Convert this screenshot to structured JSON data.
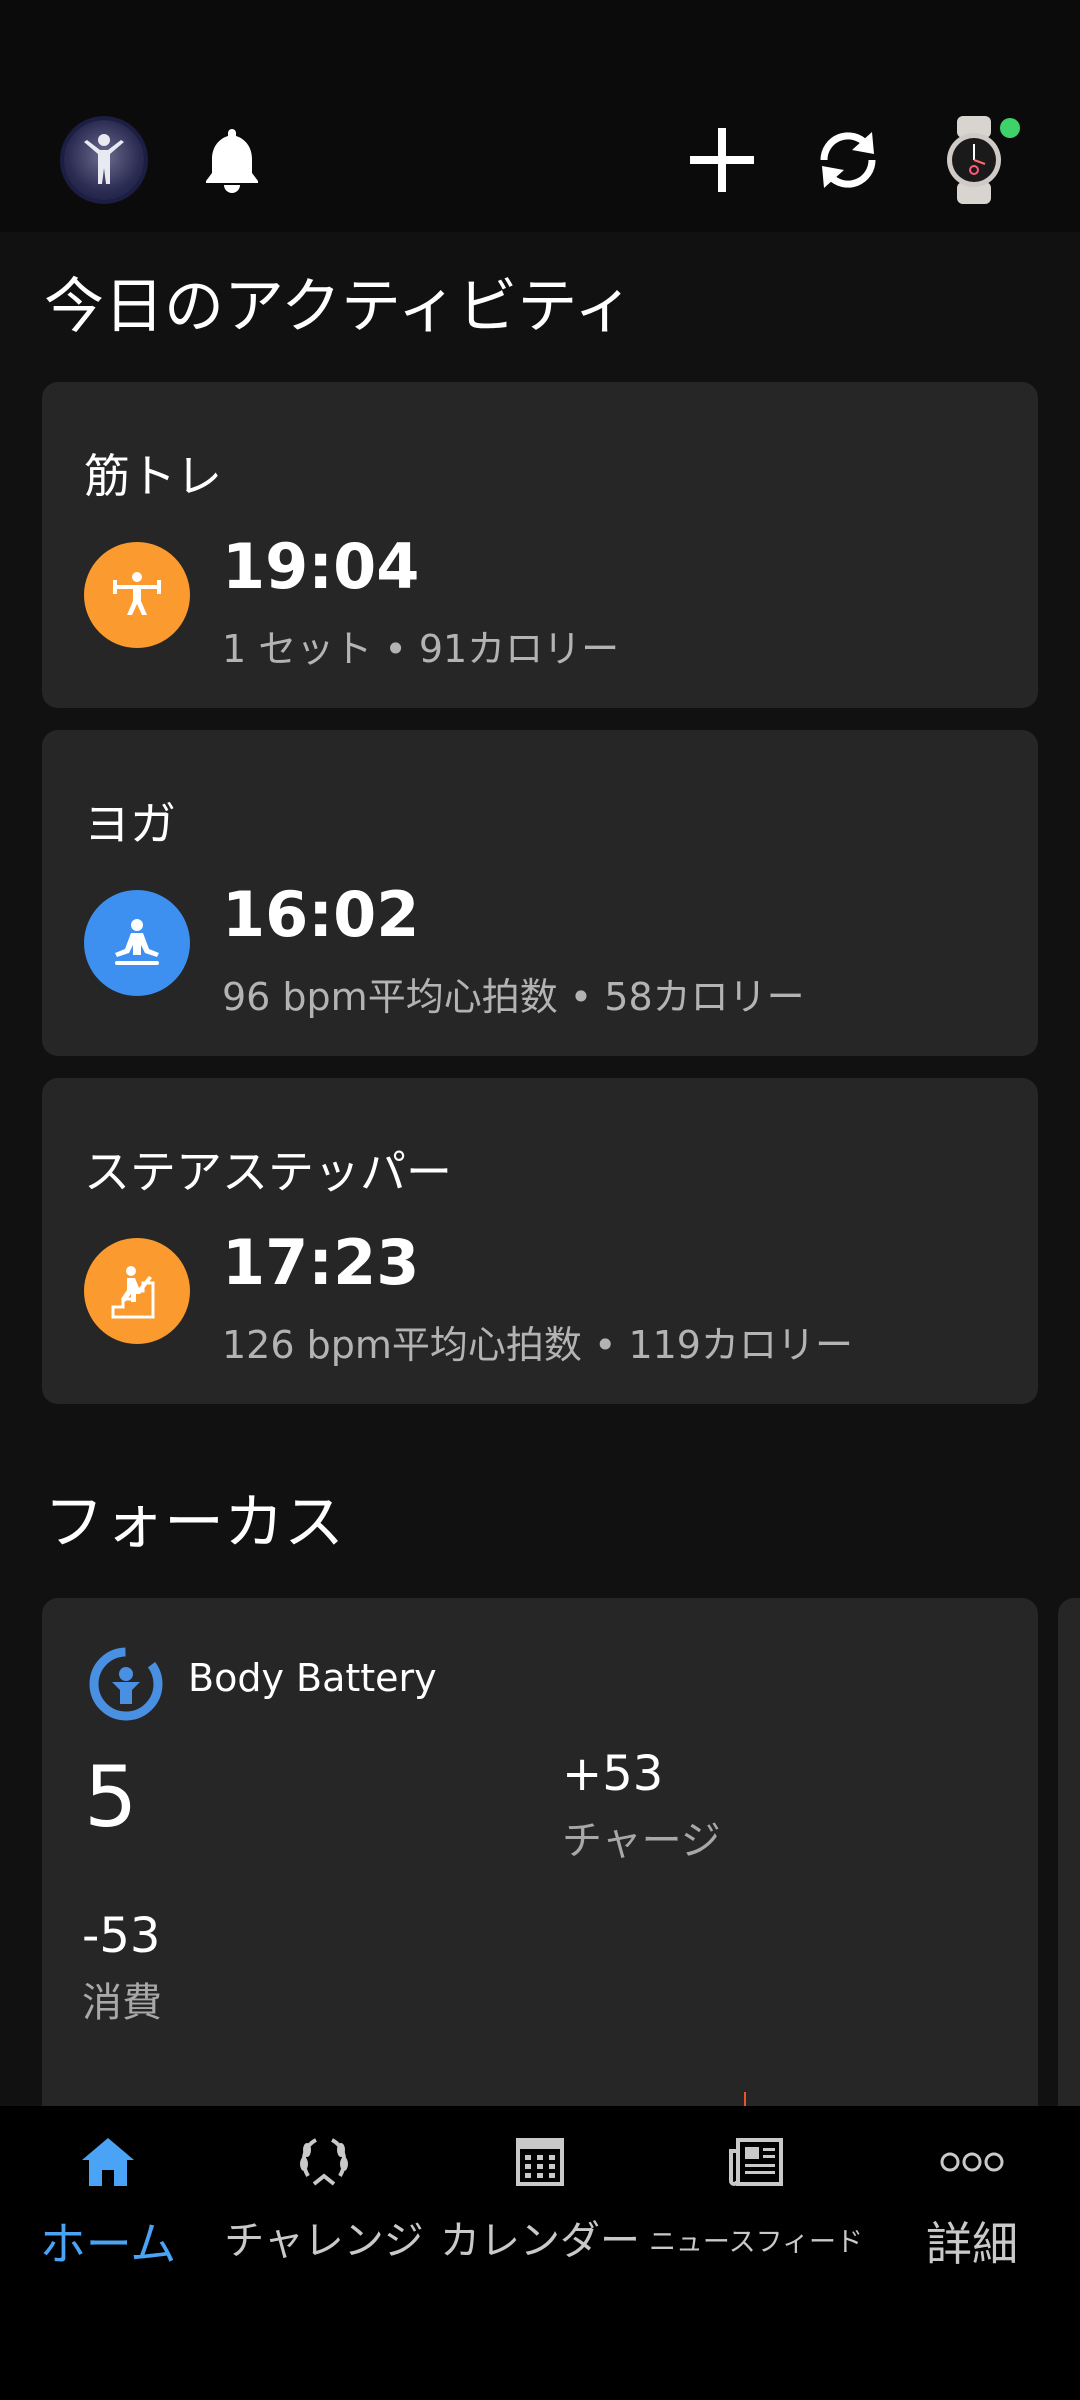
{
  "header": {
    "avatar_icon": "person-avatar-icon",
    "bell_icon": "bell-icon",
    "add_icon": "plus-icon",
    "sync_icon": "sync-icon",
    "watch_icon": "watch-icon",
    "watch_status_color": "#3fd26a"
  },
  "activities": {
    "title": "今日のアクティビティ",
    "items": [
      {
        "name": "筋トレ",
        "time": "19:04",
        "detail": "1 セット • 91カロリー",
        "icon": "weightlifting-icon",
        "color": "#fb9a2e"
      },
      {
        "name": "ヨガ",
        "time": "16:02",
        "detail": "96 bpm平均心拍数 • 58カロリー",
        "icon": "yoga-icon",
        "color": "#3d8ff0"
      },
      {
        "name": "ステアステッパー",
        "time": "17:23",
        "detail": "126 bpm平均心拍数 • 119カロリー",
        "icon": "stair-stepper-icon",
        "color": "#fb9a2e"
      }
    ]
  },
  "focus": {
    "title": "フォーカス",
    "body_battery": {
      "title": "Body Battery",
      "value": "5",
      "charged_value": "+53",
      "charged_label": "チャージ",
      "drained_value": "-53",
      "drained_label": "消費",
      "accent": "#4a90e2"
    }
  },
  "nav": {
    "items": [
      {
        "label": "ホーム",
        "icon": "home-icon",
        "active": true
      },
      {
        "label": "チャレンジ",
        "icon": "laurel-icon"
      },
      {
        "label": "カレンダー",
        "icon": "calendar-icon"
      },
      {
        "label": "ニュースフィード",
        "icon": "newsfeed-icon"
      },
      {
        "label": "詳細",
        "icon": "more-icon"
      }
    ],
    "active_color": "#4aa3f5"
  }
}
